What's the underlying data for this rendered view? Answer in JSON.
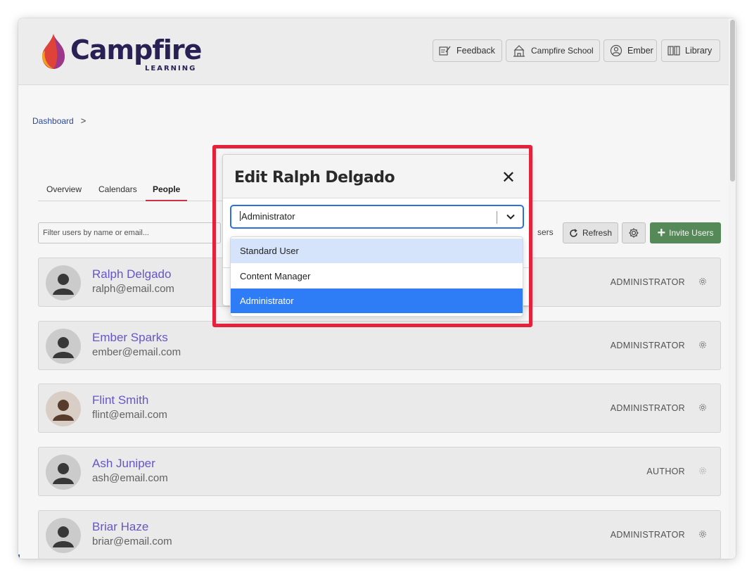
{
  "brand": {
    "name": "Campfire",
    "sub": "LEARNING",
    "flame_colors": [
      "#f6a623",
      "#e8453c",
      "#a33a8e"
    ],
    "text_color": "#2b2358"
  },
  "header_buttons": [
    {
      "label": "Feedback",
      "icon": "feedback-icon"
    },
    {
      "label": "Campfire School",
      "icon": "school-icon"
    },
    {
      "label": "Ember",
      "icon": "user-circle-icon"
    },
    {
      "label": "Library",
      "icon": "library-icon"
    }
  ],
  "breadcrumb": {
    "item": "Dashboard",
    "separator": ">"
  },
  "tabs": [
    {
      "label": "Overview"
    },
    {
      "label": "Calendars"
    },
    {
      "label": "People",
      "active": true
    }
  ],
  "filter": {
    "placeholder": "Filter users by name or email..."
  },
  "toolbar": {
    "users_fragment": "sers",
    "refresh_label": "Refresh",
    "invite_label": "Invite Users"
  },
  "users": [
    {
      "name": "Ralph Delgado",
      "email": "ralph@email.com",
      "role": "ADMINISTRATOR"
    },
    {
      "name": "Ember Sparks",
      "email": "ember@email.com",
      "role": "ADMINISTRATOR"
    },
    {
      "name": "Flint Smith",
      "email": "flint@email.com",
      "role": "ADMINISTRATOR"
    },
    {
      "name": "Ash Juniper",
      "email": "ash@email.com",
      "role": "AUTHOR"
    },
    {
      "name": "Briar Haze",
      "email": "briar@email.com",
      "role": "ADMINISTRATOR"
    }
  ],
  "modal": {
    "title": "Edit Ralph Delgado",
    "close_glyph": "✕",
    "role_select": {
      "value": "Administrator",
      "options": [
        "Standard User",
        "Content Manager",
        "Administrator"
      ],
      "hovered": "Standard User",
      "selected": "Administrator"
    }
  },
  "colors": {
    "accent_blue": "#2f7df6",
    "invite_green": "#5a8f5c",
    "highlight_red": "#e4233a",
    "name_purple": "#6a5acd"
  }
}
